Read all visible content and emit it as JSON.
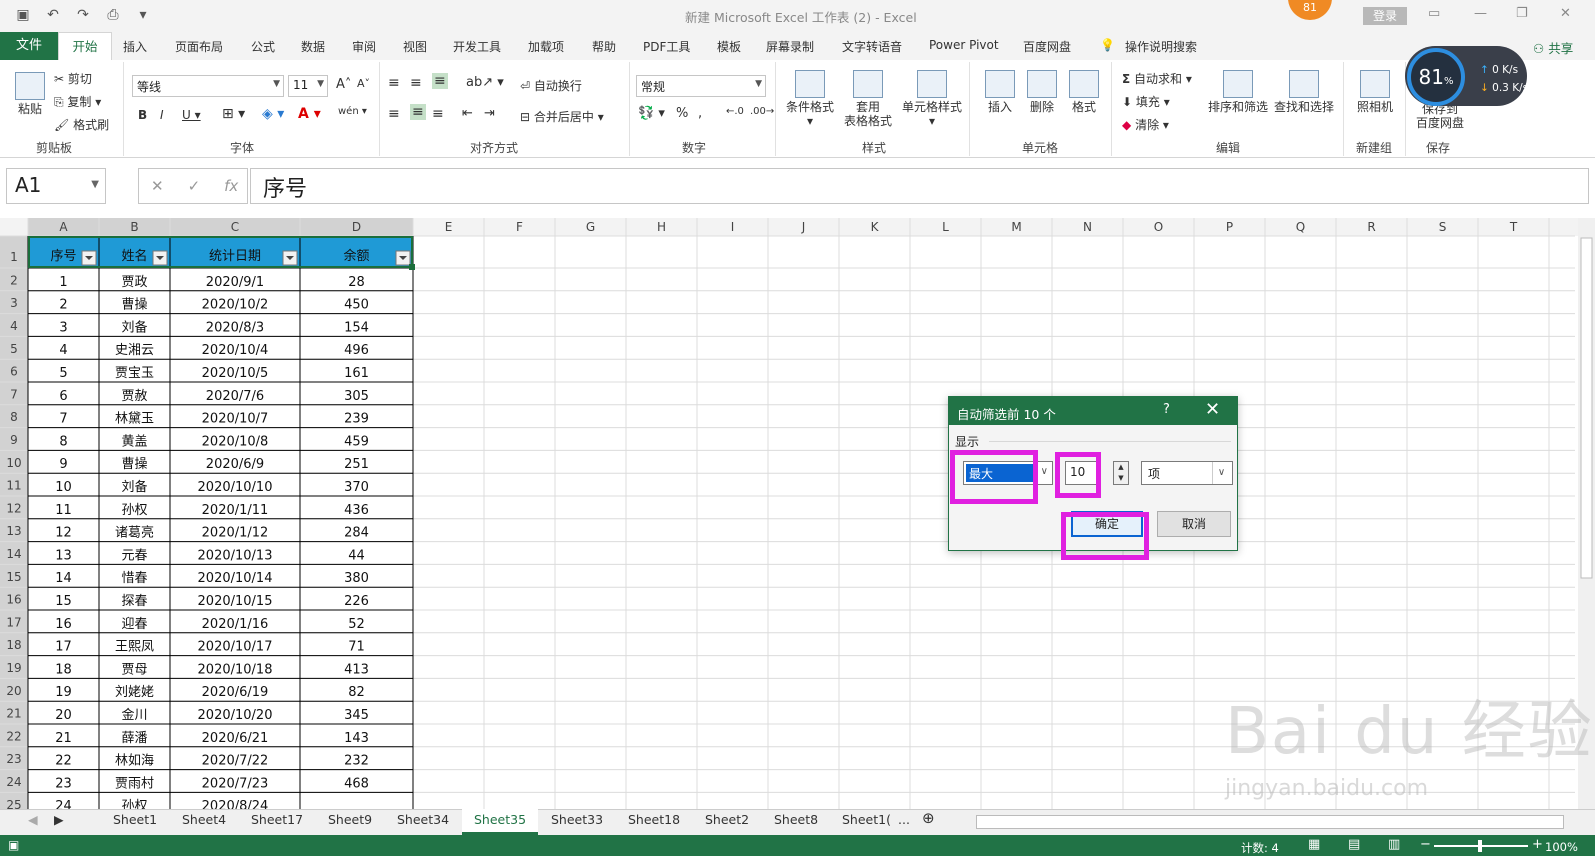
{
  "window": {
    "title": "新建 Microsoft Excel 工作表 (2)  -  Excel",
    "login_label": "登录",
    "badge": "81"
  },
  "ribbon_tabs": [
    "文件",
    "开始",
    "插入",
    "页面布局",
    "公式",
    "数据",
    "审阅",
    "视图",
    "开发工具",
    "加载项",
    "帮助",
    "PDF工具",
    "模板",
    "屏幕录制",
    "文字转语音",
    "Power Pivot",
    "百度网盘",
    "操作说明搜索"
  ],
  "share_label": "共享",
  "ribbon": {
    "clipboard": {
      "paste": "粘贴",
      "cut": "剪切",
      "copy": "复制",
      "format_painter": "格式刷",
      "group": "剪贴板"
    },
    "font": {
      "name": "等线",
      "size": "11",
      "group": "字体",
      "phonetic": "wén"
    },
    "alignment": {
      "wrap": "自动换行",
      "merge": "合并后居中",
      "group": "对齐方式"
    },
    "number": {
      "format": "常规",
      "group": "数字"
    },
    "styles": {
      "conditional": "条件格式",
      "table": "套用\n表格格式",
      "cell": "单元格样式",
      "group": "样式"
    },
    "cells": {
      "insert": "插入",
      "delete": "删除",
      "format": "格式",
      "group": "单元格"
    },
    "editing": {
      "autosum": "自动求和",
      "fill": "填充",
      "clear": "清除",
      "sort": "排序和筛选",
      "find": "查找和选择",
      "group": "编辑"
    },
    "newgroup": {
      "camera": "照相机",
      "group": "新建组"
    },
    "save": {
      "save_baidu": "保存到\n百度网盘",
      "group": "保存"
    }
  },
  "speed_widget": {
    "percent": "81",
    "unit": "%",
    "up": "0 K/s",
    "down": "0.3 K/s"
  },
  "formula_bar": {
    "cell_ref": "A1",
    "content": "序号"
  },
  "columns": [
    "A",
    "B",
    "C",
    "D",
    "E",
    "F",
    "G",
    "H",
    "I",
    "J",
    "K",
    "L",
    "M",
    "N",
    "O",
    "P",
    "Q",
    "R",
    "S",
    "T"
  ],
  "table": {
    "headers": [
      "序号",
      "姓名",
      "统计日期",
      "余额"
    ],
    "rows": [
      [
        "1",
        "贾政",
        "2020/9/1",
        "28"
      ],
      [
        "2",
        "曹操",
        "2020/10/2",
        "450"
      ],
      [
        "3",
        "刘备",
        "2020/8/3",
        "154"
      ],
      [
        "4",
        "史湘云",
        "2020/10/4",
        "496"
      ],
      [
        "5",
        "贾宝玉",
        "2020/10/5",
        "161"
      ],
      [
        "6",
        "贾赦",
        "2020/7/6",
        "305"
      ],
      [
        "7",
        "林黛玉",
        "2020/10/7",
        "239"
      ],
      [
        "8",
        "黄盖",
        "2020/10/8",
        "459"
      ],
      [
        "9",
        "曹操",
        "2020/6/9",
        "251"
      ],
      [
        "10",
        "刘备",
        "2020/10/10",
        "370"
      ],
      [
        "11",
        "孙权",
        "2020/1/11",
        "436"
      ],
      [
        "12",
        "诸葛亮",
        "2020/1/12",
        "284"
      ],
      [
        "13",
        "元春",
        "2020/10/13",
        "44"
      ],
      [
        "14",
        "惜春",
        "2020/10/14",
        "380"
      ],
      [
        "15",
        "探春",
        "2020/10/15",
        "226"
      ],
      [
        "16",
        "迎春",
        "2020/1/16",
        "52"
      ],
      [
        "17",
        "王熙凤",
        "2020/10/17",
        "71"
      ],
      [
        "18",
        "贾母",
        "2020/10/18",
        "413"
      ],
      [
        "19",
        "刘姥姥",
        "2020/6/19",
        "82"
      ],
      [
        "20",
        "金川",
        "2020/10/20",
        "345"
      ],
      [
        "21",
        "薛潘",
        "2020/6/21",
        "143"
      ],
      [
        "22",
        "林如海",
        "2020/7/22",
        "232"
      ],
      [
        "23",
        "贾雨村",
        "2020/7/23",
        "468"
      ],
      [
        "24",
        "孙权",
        "2020/8/24",
        ""
      ]
    ]
  },
  "dialog": {
    "title": "自动筛选前 10 个",
    "help": "?",
    "show_label": "显示",
    "direction_value": "最大",
    "count_value": "10",
    "unit_value": "项",
    "ok_label": "确定",
    "cancel_label": "取消"
  },
  "sheet_tabs": [
    "Sheet1",
    "Sheet4",
    "Sheet17",
    "Sheet9",
    "Sheet34",
    "Sheet35",
    "Sheet33",
    "Sheet18",
    "Sheet2",
    "Sheet8",
    "Sheet1("
  ],
  "sheet_more": "...",
  "active_sheet": "Sheet35",
  "status": {
    "count": "计数: 4",
    "zoom": "100%"
  },
  "watermark": {
    "main": "Bai du 经验",
    "sub": "jingyan.baidu.com"
  },
  "colors": {
    "excel_green": "#217346",
    "highlight": "#e020e0",
    "header_fill": "#1f9ad6"
  }
}
